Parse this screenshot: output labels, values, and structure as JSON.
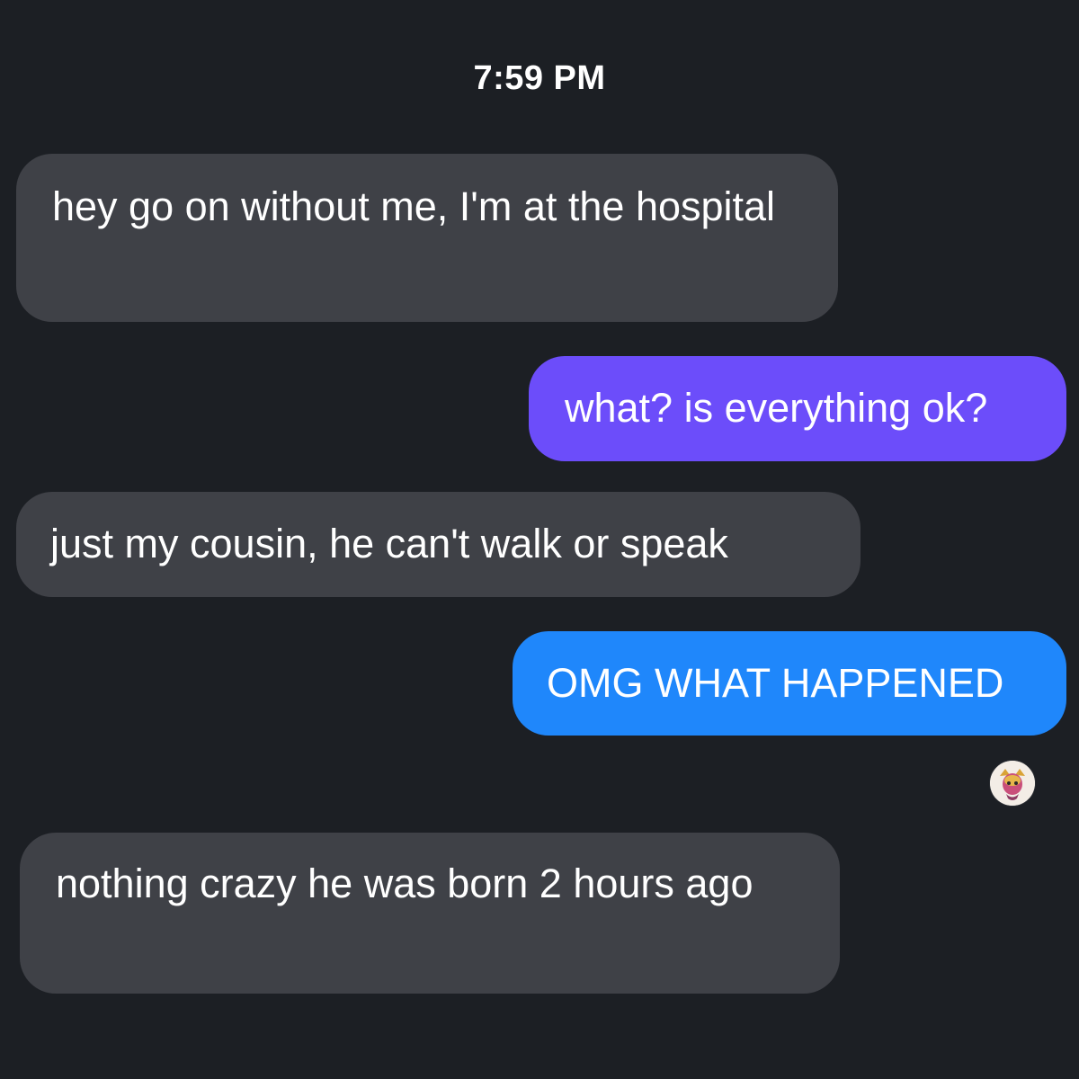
{
  "chat": {
    "timestamp": "7:59 PM",
    "messages": [
      {
        "direction": "incoming",
        "text": "hey go on without me, I'm at the hospital",
        "color": "#3f4147"
      },
      {
        "direction": "outgoing",
        "text": "what? is everything ok?",
        "color": "#6c4dfa"
      },
      {
        "direction": "incoming",
        "text": "just my cousin, he can't walk or speak",
        "color": "#3f4147"
      },
      {
        "direction": "outgoing",
        "text": "OMG WHAT HAPPENED",
        "color": "#1f87fb"
      },
      {
        "direction": "incoming",
        "text": "nothing crazy he was born 2 hours ago",
        "color": "#3f4147"
      }
    ],
    "read_receipt_avatar": "avatar-icon"
  },
  "colors": {
    "background": "#1c1f24",
    "incoming_bubble": "#3f4147",
    "outgoing_bubble_purple": "#6c4dfa",
    "outgoing_bubble_blue": "#1f87fb",
    "text": "#ffffff"
  }
}
